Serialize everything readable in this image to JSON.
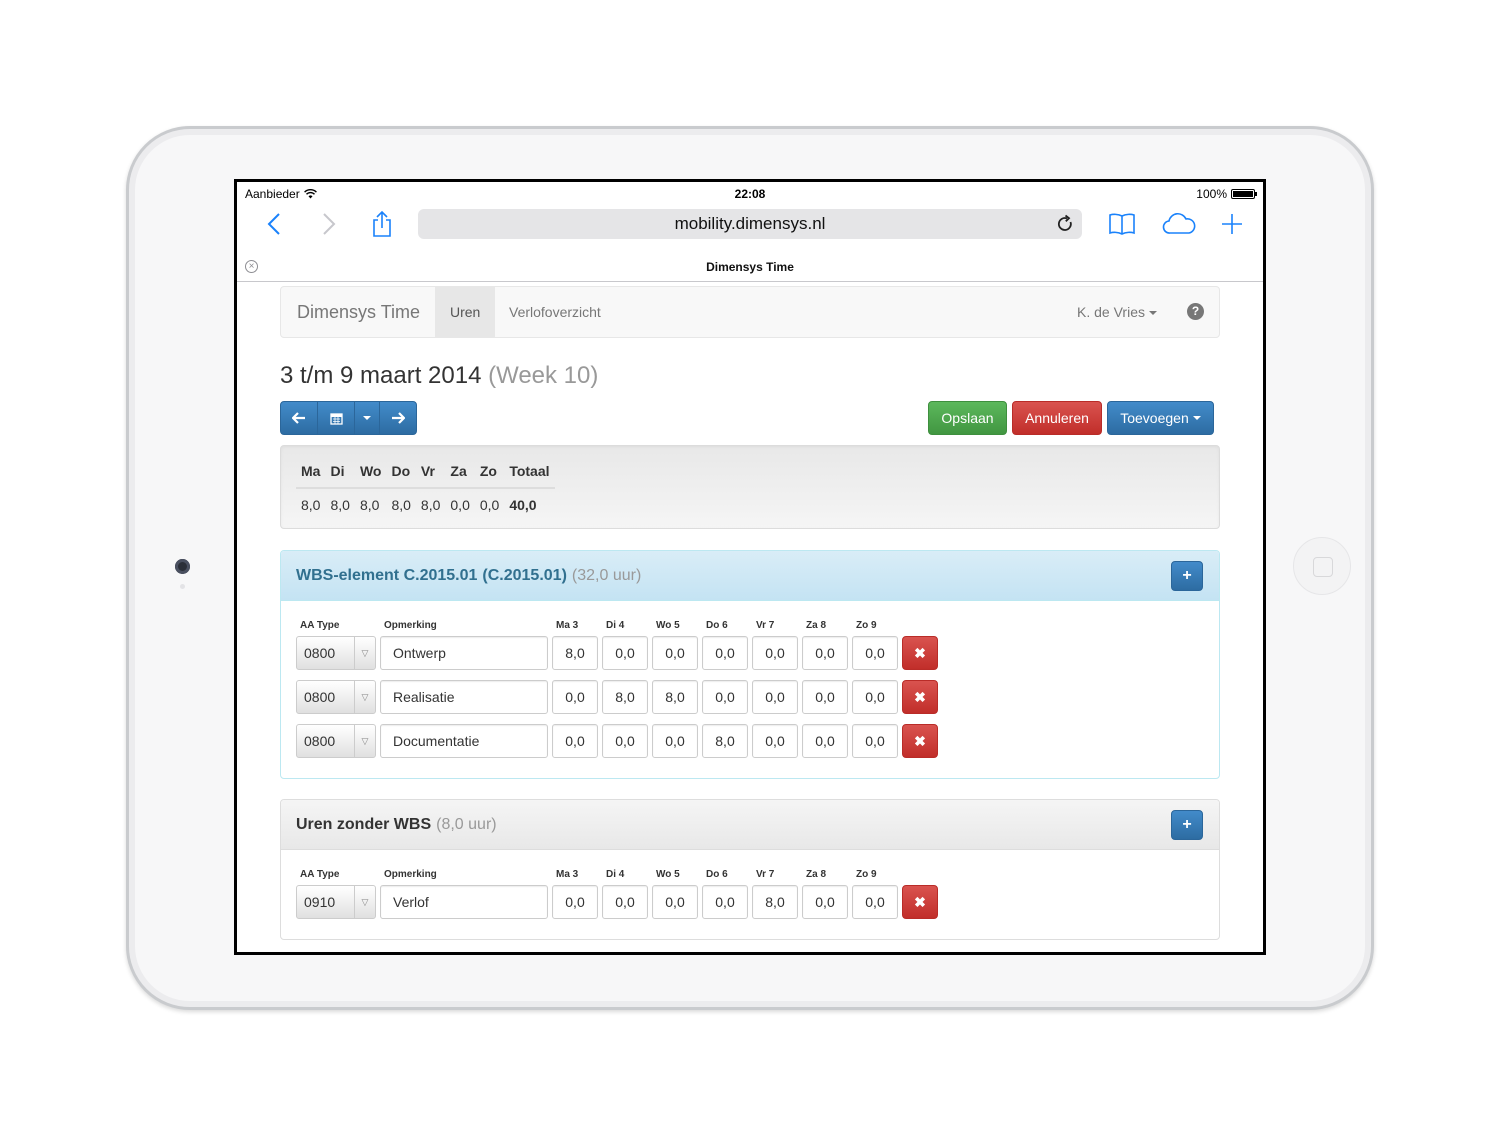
{
  "statusbar": {
    "carrier": "Aanbieder",
    "time": "22:08",
    "battery": "100%"
  },
  "safari": {
    "url": "mobility.dimensys.nl",
    "tab_title": "Dimensys Time"
  },
  "navbar": {
    "brand": "Dimensys Time",
    "tabs": [
      {
        "label": "Uren"
      },
      {
        "label": "Verlofoverzicht"
      }
    ],
    "user": "K. de Vries"
  },
  "header": {
    "title": "3 t/m 9 maart 2014",
    "week": "(Week 10)"
  },
  "actions": {
    "save": "Opslaan",
    "cancel": "Annuleren",
    "add": "Toevoegen"
  },
  "summary": {
    "headers": [
      "Ma",
      "Di",
      "Wo",
      "Do",
      "Vr",
      "Za",
      "Zo",
      "Totaal"
    ],
    "values": [
      "8,0",
      "8,0",
      "8,0",
      "8,0",
      "8,0",
      "0,0",
      "0,0",
      "40,0"
    ]
  },
  "columns": {
    "type": "AA Type",
    "remark": "Opmerking",
    "days": [
      "Ma 3",
      "Di 4",
      "Wo 5",
      "Do 6",
      "Vr 7",
      "Za 8",
      "Zo 9"
    ]
  },
  "panels": [
    {
      "title": "WBS-element C.2015.01",
      "code": "(C.2015.01)",
      "hours": "(32,0 uur)",
      "rows": [
        {
          "type": "0800",
          "remark": "Ontwerp",
          "days": [
            "8,0",
            "0,0",
            "0,0",
            "0,0",
            "0,0",
            "0,0",
            "0,0"
          ]
        },
        {
          "type": "0800",
          "remark": "Realisatie",
          "days": [
            "0,0",
            "8,0",
            "8,0",
            "0,0",
            "0,0",
            "0,0",
            "0,0"
          ]
        },
        {
          "type": "0800",
          "remark": "Documentatie",
          "days": [
            "0,0",
            "0,0",
            "0,0",
            "8,0",
            "0,0",
            "0,0",
            "0,0"
          ]
        }
      ]
    },
    {
      "title": "Uren zonder WBS",
      "hours": "(8,0 uur)",
      "rows": [
        {
          "type": "0910",
          "remark": "Verlof",
          "days": [
            "0,0",
            "0,0",
            "0,0",
            "0,0",
            "8,0",
            "0,0",
            "0,0"
          ]
        }
      ]
    }
  ],
  "colors": {
    "primary": "#428bca",
    "success": "#5cb85c",
    "danger": "#d9534f",
    "info_heading": "#d9edf7",
    "ios_blue": "#1a82fb"
  }
}
